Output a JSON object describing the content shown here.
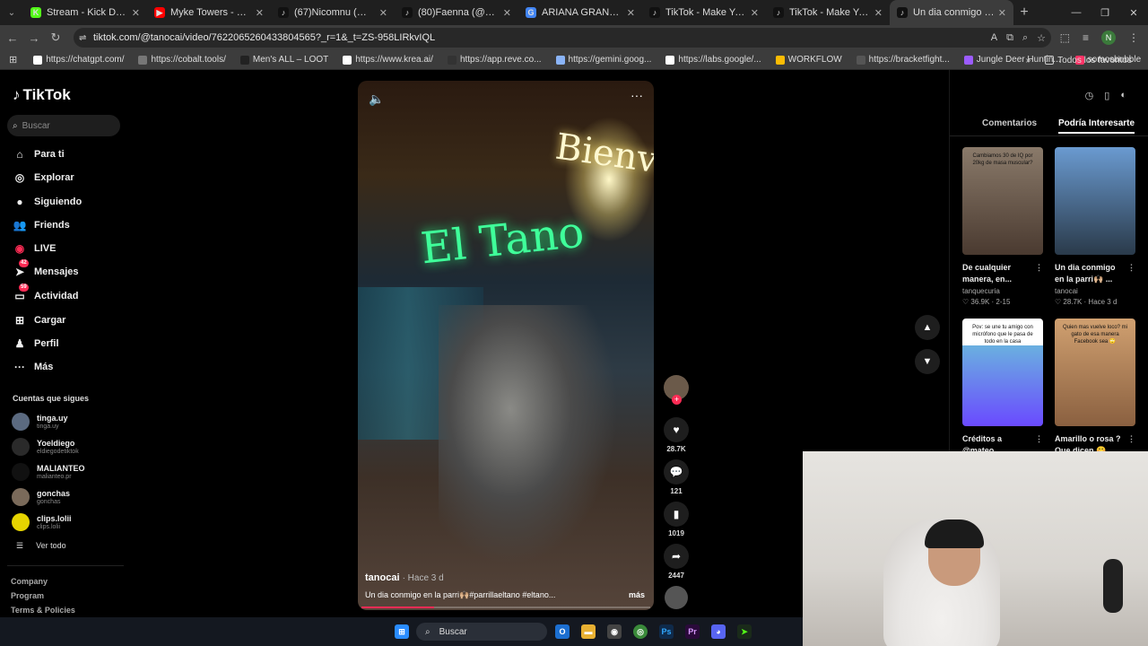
{
  "browser": {
    "tabs": [
      {
        "label": "Stream - Kick Dashboard",
        "fav_color": "#53fc18",
        "fav_glyph": "K"
      },
      {
        "label": "Myke Towers - Parcerita (",
        "fav_color": "#ff0000",
        "fav_glyph": "▶"
      },
      {
        "label": "(67)Nicomnu (@nicomnu",
        "fav_color": "#111111",
        "fav_glyph": "♪"
      },
      {
        "label": "(80)Faenna (@akafaenna)",
        "fav_color": "#111111",
        "fav_glyph": "♪"
      },
      {
        "label": "ARIANA GRANDE EDAD -",
        "fav_color": "#4285f4",
        "fav_glyph": "G"
      },
      {
        "label": "TikTok - Make Your Day",
        "fav_color": "#111111",
        "fav_glyph": "♪"
      },
      {
        "label": "TikTok - Make Your Day",
        "fav_color": "#111111",
        "fav_glyph": "♪"
      },
      {
        "label": "Un dia conmigo en la",
        "fav_color": "#111111",
        "fav_glyph": "♪",
        "active": true
      }
    ],
    "url": "tiktok.com/@tanocai/video/7622065260433804565?_r=1&_t=ZS-958LIRkvIQL",
    "profile_initial": "N",
    "bookmarks": [
      {
        "label": "https://chatgpt.com/",
        "color": "#ffffff"
      },
      {
        "label": "https://cobalt.tools/",
        "color": "#777777"
      },
      {
        "label": "Men's ALL – LOOT",
        "color": "#222222"
      },
      {
        "label": "https://www.krea.ai/",
        "color": "#ffffff"
      },
      {
        "label": "https://app.reve.co...",
        "color": "#333333"
      },
      {
        "label": "https://gemini.goog...",
        "color": "#8ab4f8"
      },
      {
        "label": "https://labs.google/...",
        "color": "#ffffff"
      },
      {
        "label": "WORKFLOW",
        "color": "#fbbc04"
      },
      {
        "label": "https://bracketfight...",
        "color": "#555555"
      },
      {
        "label": "Jungle Deer Huntin...",
        "color": "#9c5cff"
      },
      {
        "label": "somosbubble",
        "color": "#ff3366"
      }
    ],
    "all_bookmarks_label": "Todos los favoritos"
  },
  "sidebar": {
    "logo": "TikTok",
    "search_placeholder": "Buscar",
    "nav": [
      {
        "label": "Para ti",
        "icon": "home-icon",
        "glyph": "⌂"
      },
      {
        "label": "Explorar",
        "icon": "compass-icon",
        "glyph": "◎"
      },
      {
        "label": "Siguiendo",
        "icon": "following-avatar-icon",
        "glyph": "●"
      },
      {
        "label": "Friends",
        "icon": "friends-icon",
        "glyph": "👥"
      },
      {
        "label": "LIVE",
        "icon": "live-icon",
        "glyph": "◉"
      },
      {
        "label": "Mensajes",
        "icon": "messages-icon",
        "glyph": "➤",
        "badge": "42"
      },
      {
        "label": "Actividad",
        "icon": "activity-icon",
        "glyph": "▭",
        "badge": "59"
      },
      {
        "label": "Cargar",
        "icon": "upload-icon",
        "glyph": "⊞"
      },
      {
        "label": "Perfil",
        "icon": "profile-icon",
        "glyph": "♟"
      },
      {
        "label": "Más",
        "icon": "more-icon",
        "glyph": "···"
      }
    ],
    "following_title": "Cuentas que sigues",
    "following": [
      {
        "name": "tinga.uy",
        "handle": "tinga.uy",
        "color": "#5b6a80"
      },
      {
        "name": "Yoeldiego",
        "handle": "eldiegodetiktok",
        "color": "#2a2a2a"
      },
      {
        "name": "MALIANTEO",
        "handle": "malianteo.pr",
        "color": "#111111"
      },
      {
        "name": "gonchas",
        "handle": "gonchas",
        "color": "#7a6a5a"
      },
      {
        "name": "clips.lolii",
        "handle": "clips.lolii",
        "color": "#e6d400"
      }
    ],
    "see_all": "Ver todo",
    "footer": [
      "Company",
      "Program",
      "Terms & Policies"
    ]
  },
  "video": {
    "username": "tanocai",
    "time": "· Hace 3 d",
    "description": "Un dia conmigo en la parri🙌🏼#parrillaeltano #eltano...",
    "more": "más",
    "progress": 0.25,
    "sign_text": "Bienve",
    "neon_text": "El Tano"
  },
  "actions": {
    "likes": "28.7K",
    "comments": "121",
    "saves": "1019",
    "shares": "2447"
  },
  "right_panel": {
    "tab_comments": "Comentarios",
    "tab_suggested": "Podría Interesarte",
    "cards": [
      {
        "title": "De cualquier manera, en...",
        "user": "tanquecuria",
        "stats": "♡ 36.9K · 2-15",
        "thumb_text": "Cambiamos 30 de IQ por 20kg de masa muscular?",
        "colors": [
          "#8a7a6a",
          "#4a3a30"
        ]
      },
      {
        "title": "Un dia conmigo en la parri🙌🏼 ...",
        "user": "tanocai",
        "stats": "♡ 28.7K · Hace 3 d",
        "thumb_text": "",
        "colors": [
          "#6a9ad0",
          "#2a3a4a"
        ]
      },
      {
        "title": "Créditos a @mateo #fortnite...",
        "user": "",
        "stats": "",
        "thumb_text": "Pov: se une tu amigo con micrófono que le pasa de todo en la casa",
        "colors": [
          "#6ab0e0",
          "#6a4aff"
        ]
      },
      {
        "title": "Amarillo o rosa ? Que dicen 🤭",
        "user": "",
        "stats": "",
        "thumb_text": "Quien mas vuelve loco? mi gato de esa manera Facebook sea 🙄",
        "colors": [
          "#d0a070",
          "#8a6040"
        ]
      }
    ]
  },
  "taskbar": {
    "search": "Buscar"
  }
}
